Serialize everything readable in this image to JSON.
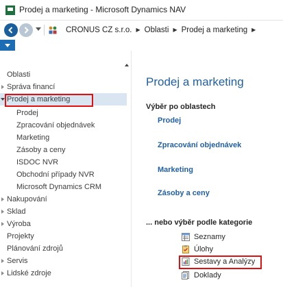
{
  "window": {
    "title": "Prodej a marketing - Microsoft Dynamics NAV"
  },
  "navbar": {
    "breadcrumbs": [
      "CRONUS CZ s.r.o.",
      "Oblasti",
      "Prodej a marketing"
    ]
  },
  "sidebar": {
    "items": [
      {
        "label": "Oblasti"
      },
      {
        "label": "Správa financí"
      },
      {
        "label": "Prodej a marketing"
      },
      {
        "label": "Prodej"
      },
      {
        "label": "Zpracování objednávek"
      },
      {
        "label": "Marketing"
      },
      {
        "label": "Zásoby a ceny"
      },
      {
        "label": "ISDOC NVR"
      },
      {
        "label": "Obchodní případy NVR"
      },
      {
        "label": "Microsoft Dynamics CRM"
      },
      {
        "label": "Nakupování"
      },
      {
        "label": "Sklad"
      },
      {
        "label": "Výroba"
      },
      {
        "label": "Projekty"
      },
      {
        "label": "Plánování zdrojů"
      },
      {
        "label": "Servis"
      },
      {
        "label": "Lidské zdroje"
      }
    ]
  },
  "content": {
    "title": "Prodej a marketing",
    "areas_heading": "Výběr po oblastech",
    "areas": [
      "Prodej",
      "Zpracování objednávek",
      "Marketing",
      "Zásoby a ceny"
    ],
    "categories_heading": "... nebo výběr podle kategorie",
    "categories": [
      {
        "label": "Seznamy",
        "icon": "list-icon"
      },
      {
        "label": "Úlohy",
        "icon": "tasks-icon"
      },
      {
        "label": "Sestavy a Analýzy",
        "icon": "reports-icon"
      },
      {
        "label": "Doklady",
        "icon": "documents-icon"
      }
    ]
  },
  "colors": {
    "accent": "#1f5fa6",
    "selection": "#d9e6f2",
    "highlight_box": "#e01010"
  }
}
